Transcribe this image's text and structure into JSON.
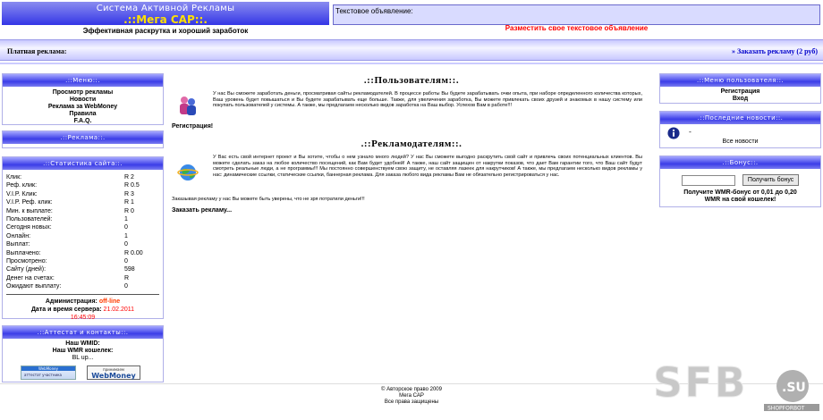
{
  "header": {
    "title_line1": "Система Активной Рекламы",
    "title_line2": ".::Мега САР::.",
    "slogan": "Эффективная раскрутка и хороший заработок",
    "text_ad_label": "Текстовое объявление:",
    "place_ad_link": "Разместить свое текстовое объявление"
  },
  "paid_bar": {
    "label": "Платная реклама:",
    "order_link": "» Заказать рекламу (2 руб)"
  },
  "left": {
    "menu_title": ".::Меню::.",
    "menu_items": [
      "Просмотр рекламы",
      "Новости",
      "Реклама за WebMoney",
      "Правила",
      "F.A.Q."
    ],
    "ads_title": ".::Реклама::.",
    "stats_title": ".::Статистика сайта::.",
    "stats": [
      {
        "k": "Клик:",
        "v": "R 2"
      },
      {
        "k": "Реф. клик:",
        "v": "R 0.5"
      },
      {
        "k": "V.I.P. Клик:",
        "v": "R 3"
      },
      {
        "k": "V.I.P. Реф. клик:",
        "v": "R 1"
      },
      {
        "k": "Мин. к выплате:",
        "v": "R 0"
      },
      {
        "k": "Пользователей:",
        "v": "1"
      },
      {
        "k": "Сегодня новых:",
        "v": "0"
      },
      {
        "k": "Онлайн:",
        "v": "1"
      },
      {
        "k": "Выплат:",
        "v": "0"
      },
      {
        "k": "Выплачено:",
        "v": "R 0.00"
      },
      {
        "k": "Просмотрено:",
        "v": "0"
      },
      {
        "k": "Сайту (дней):",
        "v": "598"
      },
      {
        "k": "Денег на счетах:",
        "v": "R"
      },
      {
        "k": "Ожидают выплату:",
        "v": "0"
      }
    ],
    "admin_label": "Администрация:",
    "admin_status": "off-line",
    "server_time_label": "Дата и время сервера:",
    "server_date": "21.02.2011",
    "server_time": "16:45:09",
    "contacts_title": ".::Аттестат и контакты::.",
    "wmid_label": "Наш WMID:",
    "wmr_label": "Наш WMR кошелек:",
    "contact_extra": "BL up...",
    "badge1_top": "WebMoney",
    "badge1_bottom": "аттестат участника",
    "badge2_top": "принимаем",
    "badge2_bottom": "WebMoney"
  },
  "main": {
    "users_title": ".::Пользователям::.",
    "users_text": "У нас Вы сможете заработать деньги, просматривая сайты рекламодателей. В процессе работы Вы будете зарабатывать очки опыта, при наборе определенного количества которых, Ваш уровень будет повышаться и Вы будете зарабатывать еще больше. Также, для увеличения заработка, Вы можете привлекать своих друзей и знакомых в нашу систему или покупать пользователей у системы. А также, мы предлагаем несколько видов заработка на Ваш выбор. Успехов Вам в работе!!!",
    "register_link": "Регистрация!",
    "advertisers_title": ".::Рекламодателям::.",
    "advertisers_text": "У Вас есть свой интернет проект и Вы хотите, чтобы о нем узнало много людей? У нас Вы сможете выгодно раскрутить свой сайт и привлечь своих потенциальных клиентов. Вы можете сделать заказ на любое количество посещений, как Вам будет удобней! А также, наш сайт защищен от накрутки показов, что дает Вам гарантии того, что Ваш сайт будут смотреть реальные люди, а не программы!!! Мы постоянно совершенствуем свою защиту, не оставляя лазеек для накрутчиков! А также, мы предлагаем несколько видов рекламы у нас: динамические ссылки, статические ссылки, баннерная реклама. Для заказа любого вида рекламы Вам не обязательно регистрироваться у нас.",
    "advertisers_tail": "Заказывая рекламу у нас Вы можете быть уверены, что не зря потратили деньги!!!",
    "order_link": "Заказать рекламу..."
  },
  "right": {
    "user_menu_title": ".::Меню пользователя::.",
    "user_menu_items": [
      "Регистрация",
      "Вход"
    ],
    "news_title": ".::Последние новости::.",
    "news_dash": "-",
    "all_news": "Все новости",
    "bonus_title": ".::Бонус::.",
    "bonus_button": "Получить бонус",
    "bonus_text_1": "Получите WMR-бонус от 0,01 до 0,20",
    "bonus_text_2": "WMR на свой кошелек!"
  },
  "footer": {
    "line1": "© Авторское право 2009",
    "line2": "Мега САР",
    "line3": "Все права защищены"
  },
  "watermark": {
    "text": "SFB",
    "suffix": ".SU",
    "sub": "SHOPFORBOT"
  },
  "colors": {
    "header_blue": "#3436e6",
    "accent_yellow": "#ffe000",
    "link_red": "#ff0000",
    "link_blue": "#0000cc"
  }
}
